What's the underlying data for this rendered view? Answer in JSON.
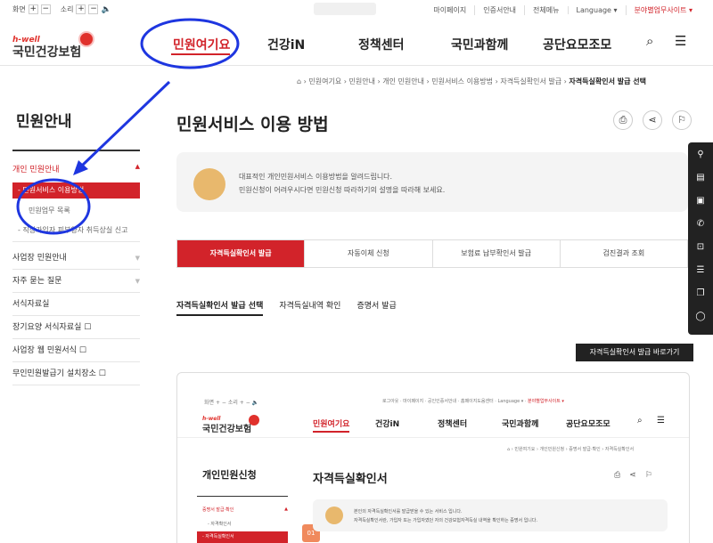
{
  "topbar": {
    "screen_label": "화면",
    "sound_label": "소리",
    "links": [
      "마이페이지",
      "인증서안내",
      "전체메뉴",
      "Language ▾",
      "분야별업무사이트 ▾"
    ]
  },
  "logo": {
    "small": "h-well",
    "main": "국민건강보험"
  },
  "gnb": [
    "민원여기요",
    "건강iN",
    "정책센터",
    "국민과함께",
    "공단요모조모"
  ],
  "breadcrumb": [
    "민원여기요",
    "민원안내",
    "개인 민원안내",
    "민원서비스 이용방법",
    "자격득실확인서 발급",
    "자격득실확인서 발급 선택"
  ],
  "sidebar": {
    "title": "민원안내",
    "group": "개인 민원안내",
    "active": "- 민원서비스 이용방법",
    "sub1": "민원업무 목록",
    "sub2": "- 직장가입자 피부양자 취득상실 신고",
    "items": [
      "사업장 민원안내",
      "자주 묻는 질문",
      "서식자료실",
      "장기요양 서식자료실 ☐",
      "사업장 웹 민원서식 ☐",
      "무인민원발급기 설치장소 ☐"
    ]
  },
  "main": {
    "title": "민원서비스 이용 방법",
    "info_line1": "대표적인 개인민원서비스 이용방법을 알려드립니다.",
    "info_line2": "민원신청이 어려우시다면 민원신청 따라하기의 설명을 따라해 보세요.",
    "tabs": [
      "자격득실확인서 발급",
      "자동이체 신청",
      "보험료 납부확인서 발급",
      "검진결과 조회"
    ],
    "subtabs": [
      "자격득실확인서 발급 선택",
      "자격득실내역 확인",
      "증명서 발급"
    ],
    "go_button": "자격득실확인서 발급 바로가기"
  },
  "inner": {
    "gnb": [
      "민원여기요",
      "건강iN",
      "정책센터",
      "국민과함께",
      "공단요모조모"
    ],
    "side_title": "개인민원신청",
    "page_title": "자격득실확인서",
    "side_group": "증명서 발급·확인",
    "side_sub": "- 자격확인서",
    "side_active": "- 자격득실확인서",
    "step": "01",
    "info1": "본인의 자격득실확인서를 발급받을 수 있는 서비스 입니다.",
    "info2": "자격득실확인서란, 가입자 또는 가입자였던 자의 건강보험자격득실 내역을 확인하는 증명서 입니다."
  },
  "colors": {
    "brand_red": "#d2232a",
    "annotation_blue": "#1e36e0"
  }
}
